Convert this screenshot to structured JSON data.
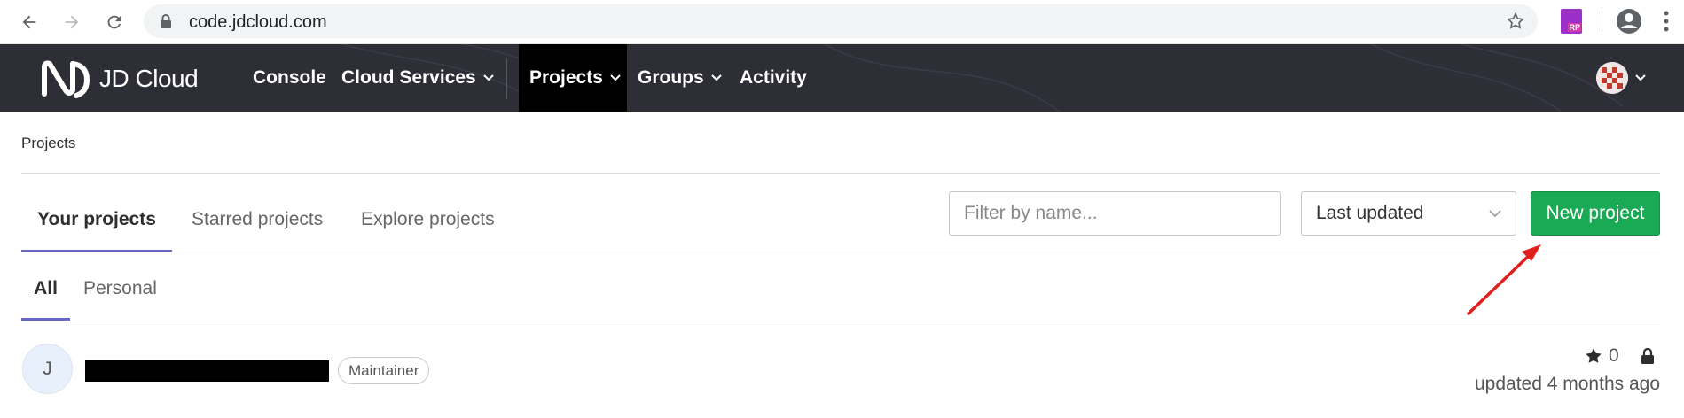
{
  "browser": {
    "url": "code.jdcloud.com",
    "extension_label": "RP"
  },
  "header": {
    "logo_text": "JD Cloud",
    "nav": {
      "console": "Console",
      "cloud_services": "Cloud Services",
      "projects": "Projects",
      "groups": "Groups",
      "activity": "Activity"
    }
  },
  "breadcrumb": "Projects",
  "tabs": {
    "your_projects": "Your projects",
    "starred_projects": "Starred projects",
    "explore_projects": "Explore projects"
  },
  "filter": {
    "placeholder": "Filter by name..."
  },
  "sort": {
    "selected": "Last updated"
  },
  "new_project_label": "New project",
  "subtabs": {
    "all": "All",
    "personal": "Personal"
  },
  "project": {
    "avatar_letter": "J",
    "role": "Maintainer",
    "stars": "0",
    "updated": "updated 4 months ago"
  },
  "colors": {
    "header_bg": "#2d2e36",
    "new_button": "#1aaa55",
    "tab_underline": "#6666c4",
    "annotation_arrow": "#e0201c"
  }
}
